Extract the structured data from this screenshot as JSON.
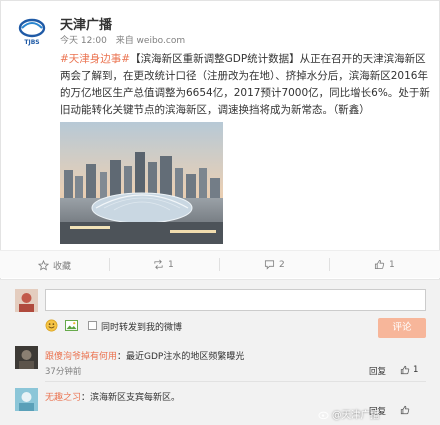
{
  "account": {
    "name": "天津广播"
  },
  "meta": {
    "time": "今天 12:00",
    "source": "来自 weibo.com"
  },
  "post": {
    "topic": "#天津身边事#",
    "body": "【滨海新区重新调整GDP统计数据】从正在召开的天津滨海新区两会了解到，在更改统计口径（注册改为在地）、挤掉水分后，滨海新区2016年的万亿地区生产总值调整为6654亿，2017预计7000亿，同比增长6%。处于新旧动能转化关键节点的滨海新区，调速换挡将成为新常态。（靳鑫）"
  },
  "actions": {
    "favorite": "收藏",
    "repost": "1",
    "comment": "2",
    "like": "1"
  },
  "composer": {
    "sync_label": "同时转发到我的微博",
    "submit_label": "评论"
  },
  "comments": [
    {
      "user": "跟傻洵爷掉有何用",
      "text": "：最近GDP注水的地区频繁曝光",
      "time": "37分钟前",
      "reply": "回复",
      "likes": "1"
    },
    {
      "user": "无趣之习",
      "text": "：滨海新区支宾每新区。",
      "time": "",
      "reply": "回复",
      "likes": ""
    }
  ],
  "watermark": "@天津广播"
}
